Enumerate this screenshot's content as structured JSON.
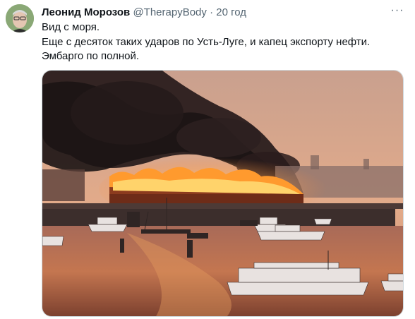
{
  "author": {
    "name": "Леонид Морозов",
    "handle": "@TherapyBody",
    "separator": "·",
    "time": "20 год"
  },
  "more_label": "···",
  "tweet": {
    "lines": [
      "Вид с моря.",
      "Еще с десяток таких ударов по Усть-Луге, и капец экспорту нефти.",
      "Эмбарго по полной."
    ]
  },
  "icons": {
    "avatar": "avatar-photo",
    "more": "more-options-icon"
  },
  "colors": {
    "name_text": "#0f1419",
    "secondary_text": "#536471",
    "fire": "#ff7a1a",
    "sky": "#d9a58b",
    "water": "#c46a4a"
  }
}
